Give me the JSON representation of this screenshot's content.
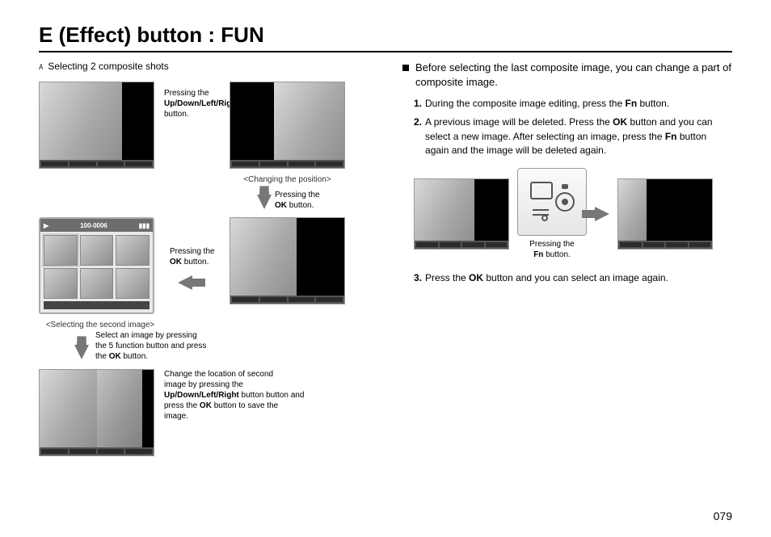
{
  "title": "E (Effect) button : FUN",
  "left": {
    "subhead_prefix": "Ä",
    "subhead": "Selecting 2 composite shots",
    "press_updown": "Pressing the",
    "press_updown_bold": "Up/Down/Left/Right",
    "press_updown_suffix": " button.",
    "caption_change_pos": "<Changing the position>",
    "press_ok_line1": "Pressing the",
    "press_ok_bold": "OK",
    "press_ok_suffix": " button.",
    "caption_select_second": "<Selecting the second image>",
    "gallery_title": "100-0006",
    "select_5fn_line1": "Select an image by pressing",
    "select_5fn_line2_a": "the 5 function button and press",
    "select_5fn_line3_a": "the ",
    "select_5fn_line3_bold": "OK",
    "select_5fn_line3_b": " button.",
    "change_loc_line1": "Change the location of second",
    "change_loc_line2_a": "image by pressing the ",
    "change_loc_line2_bold": "Up/Down/Left/Right",
    "change_loc_line3": " button button and",
    "change_loc_line4_a": "press the ",
    "change_loc_line4_bold": "OK",
    "change_loc_line4_b": " button to save the",
    "change_loc_line5": "image."
  },
  "right": {
    "heading": "Before selecting the last composite image, you can change a part of composite image.",
    "step1_a": "During the composite image editing, press the ",
    "step1_bold": "Fn",
    "step1_b": " button.",
    "step2_a": "A previous image will be deleted. Press the ",
    "step2_bold1": "OK",
    "step2_b": " button and you can select a new image. After selecting an image, press the ",
    "step2_bold2": "Fn",
    "step2_c": " button again and the image will be deleted again.",
    "press_fn_line1": "Pressing the",
    "press_fn_bold": "Fn",
    "press_fn_suffix": " button.",
    "step3_a": "Press the ",
    "step3_bold": "OK",
    "step3_b": " button and you can select an image again."
  },
  "page_number": "079"
}
